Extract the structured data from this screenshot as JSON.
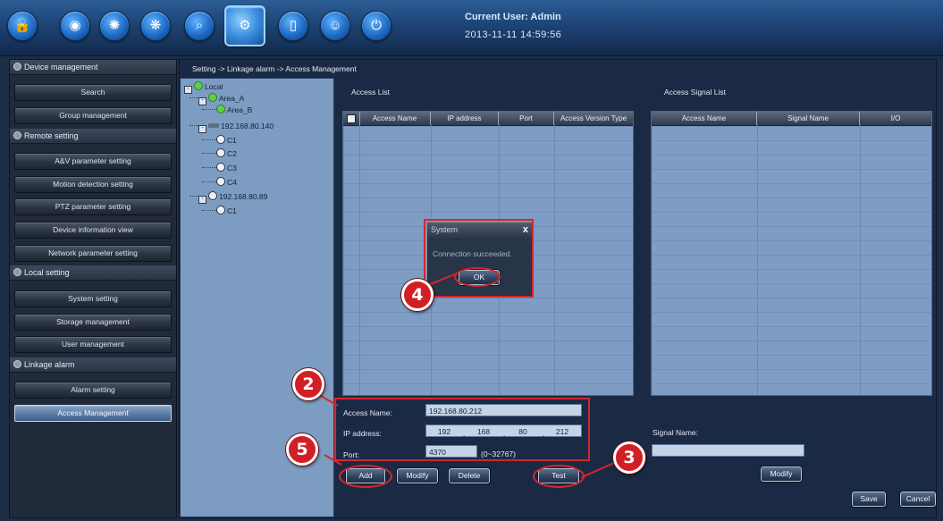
{
  "toolbar": {
    "icons": [
      "lock-icon",
      "camera-icon",
      "map-icon",
      "network-icon",
      "search-log-icon",
      "settings-icon",
      "door-icon",
      "face-icon",
      "power-icon"
    ],
    "active": "settings-icon"
  },
  "header": {
    "user_label": "Current User: Admin",
    "datetime": "2013-11-11 14:59:56"
  },
  "sidebar": {
    "sections": [
      {
        "title": "Device management",
        "items": [
          "Search",
          "Group management"
        ]
      },
      {
        "title": "Remote setting",
        "items": [
          "A&V parameter setting",
          "Motion detection setting",
          "PTZ parameter setting",
          "Device information view",
          "Network parameter setting"
        ]
      },
      {
        "title": "Local setting",
        "items": [
          "System setting",
          "Storage management",
          "User management"
        ]
      },
      {
        "title": "Linkage alarm",
        "items": [
          "Alarm setting",
          "Access Management"
        ]
      }
    ],
    "active_item": "Access Management"
  },
  "breadcrumb": "Setting -> Linkage alarm -> Access Management",
  "tree": {
    "root": "Local",
    "nodes": [
      "Area_A",
      "Area_B",
      "192.168.80.140",
      "C1",
      "C2",
      "C3",
      "C4",
      "192.168.80.89",
      "C1"
    ]
  },
  "access_list": {
    "title": "Access List",
    "columns": [
      "Access Name",
      "IP address",
      "Port",
      "Access Version Type"
    ]
  },
  "signal_list": {
    "title": "Access Signal List",
    "columns": [
      "Access Name",
      "Signal Name",
      "I/O"
    ]
  },
  "form": {
    "access_name_label": "Access Name:",
    "access_name_value": "192.168.80.212",
    "ip_label": "IP address:",
    "ip_octets": [
      "192",
      "168",
      "80",
      "212"
    ],
    "port_label": "Port:",
    "port_value": "4370",
    "port_range": "(0~32767)",
    "signal_name_label": "Signal Name:",
    "signal_name_value": ""
  },
  "buttons": {
    "add": "Add",
    "modify": "Modify",
    "delete": "Delete",
    "test": "Test",
    "signal_modify": "Modify",
    "save": "Save",
    "cancel": "Cancel"
  },
  "dialog": {
    "title": "System",
    "close": "x",
    "message": "Connection succeeded.",
    "ok": "OK"
  },
  "callouts": [
    "2",
    "3",
    "4",
    "5"
  ]
}
